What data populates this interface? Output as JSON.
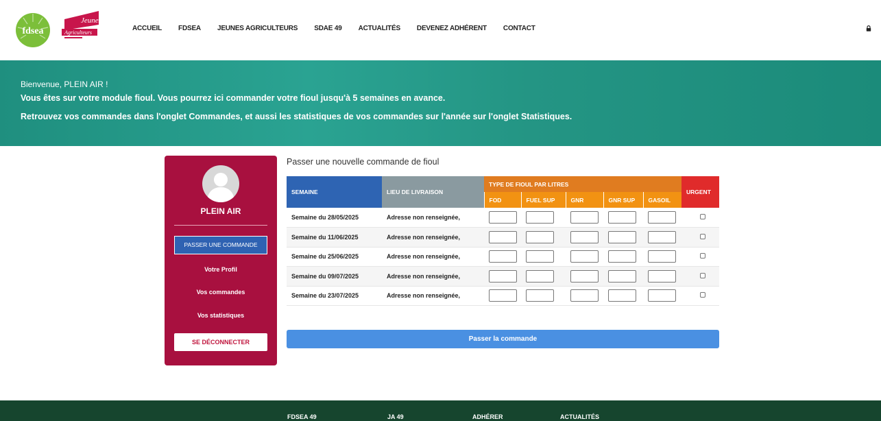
{
  "header": {
    "logo_fdsea_text": "fdsea",
    "logo_ja_text_1": "Jeunes",
    "logo_ja_text_2": "Agriculteurs",
    "nav": [
      "ACCUEIL",
      "FDSEA",
      "JEUNES AGRICULTEURS",
      "SDAE 49",
      "ACTUALITÉS",
      "DEVENEZ ADHÉRENT",
      "CONTACT"
    ],
    "lock_icon": "lock-icon"
  },
  "banner": {
    "welcome": "Bienvenue, PLEIN AIR !",
    "line1": "Vous êtes sur votre module fioul. Vous pourrez ici commander votre fioul jusqu'à 5 semaines en avance.",
    "line2": "Retrouvez vos commandes dans l'onglet Commandes, et aussi les statistiques de vos commandes sur l'année sur l'onglet Statistiques."
  },
  "sidebar": {
    "name": "PLEIN AIR",
    "order_button": "PASSER UNE COMMANDE",
    "profile": "Votre Profil",
    "orders": "Vos commandes",
    "stats": "Vos statistiques",
    "logout": "SE DÉCONNECTER"
  },
  "order": {
    "title": "Passer une nouvelle commande de fioul",
    "headers": {
      "semaine": "SEMAINE",
      "lieu": "LIEU DE LIVRAISON",
      "type": "TYPE DE FIOUL PAR LITRES",
      "urgent": "URGENT",
      "fuel_types": [
        "FOD",
        "FUEL SUP",
        "GNR",
        "GNR SUP",
        "GASOIL"
      ]
    },
    "rows": [
      {
        "semaine": "Semaine du 28/05/2025",
        "lieu": "Adresse non renseignée,"
      },
      {
        "semaine": "Semaine du 11/06/2025",
        "lieu": "Adresse non renseignée,"
      },
      {
        "semaine": "Semaine du 25/06/2025",
        "lieu": "Adresse non renseignée,"
      },
      {
        "semaine": "Semaine du 09/07/2025",
        "lieu": "Adresse non renseignée,"
      },
      {
        "semaine": "Semaine du 23/07/2025",
        "lieu": "Adresse non renseignée,"
      }
    ],
    "submit": "Passer la commande"
  },
  "footer": {
    "links": [
      "FDSEA 49",
      "JA 49",
      "ADHÉRER",
      "ACTUALITÉS"
    ]
  },
  "colors": {
    "banner": "#249584",
    "sidebar": "#a8103f",
    "primary_blue": "#2e64b3",
    "orange": "#f29212",
    "urgent_red": "#e02b2b",
    "submit_blue": "#4a90e2",
    "footer": "#16452e"
  }
}
